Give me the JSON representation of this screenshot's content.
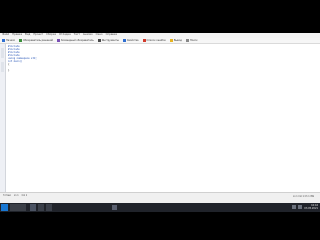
{
  "menu": {
    "items": [
      "Файл",
      "Правка",
      "Вид",
      "Проект",
      "Сборка",
      "Отладка",
      "Тест",
      "Анализ",
      "Окно",
      "Справка"
    ]
  },
  "toolbar": {
    "items": [
      {
        "label": "Начало",
        "icon": "home-icon",
        "color": "#2f6fd1"
      },
      {
        "label": "Обозреватель решений",
        "icon": "solution-explorer-icon",
        "color": "#3a8f3a"
      },
      {
        "label": "Командный обозреватель",
        "icon": "team-explorer-icon",
        "color": "#7a4fb4"
      },
      {
        "label": "Инструменты",
        "icon": "tools-icon",
        "color": "#4a4a4a"
      },
      {
        "label": "Свойства",
        "icon": "properties-icon",
        "color": "#2f6fd1"
      },
      {
        "label": "Список ошибок",
        "icon": "error-list-icon",
        "color": "#d33a2c"
      },
      {
        "label": "Вывод",
        "icon": "output-icon",
        "color": "#e6b422"
      },
      {
        "label": "Поиск",
        "icon": "search-icon",
        "color": "#888888"
      }
    ]
  },
  "editor": {
    "lines": [
      "#include",
      "#include",
      "#include",
      "#include",
      "using namespace std;",
      "int main()",
      "{",
      "  ",
      "}"
    ]
  },
  "status": {
    "left": [
      "Готово",
      "Ln 1",
      "Col 1"
    ],
    "left2": "Добавить в систему",
    "right": "Ln 1  Col 1  Ch 1  INS"
  },
  "taskbar": {
    "time": "10:16",
    "date": "03.05.2021"
  }
}
